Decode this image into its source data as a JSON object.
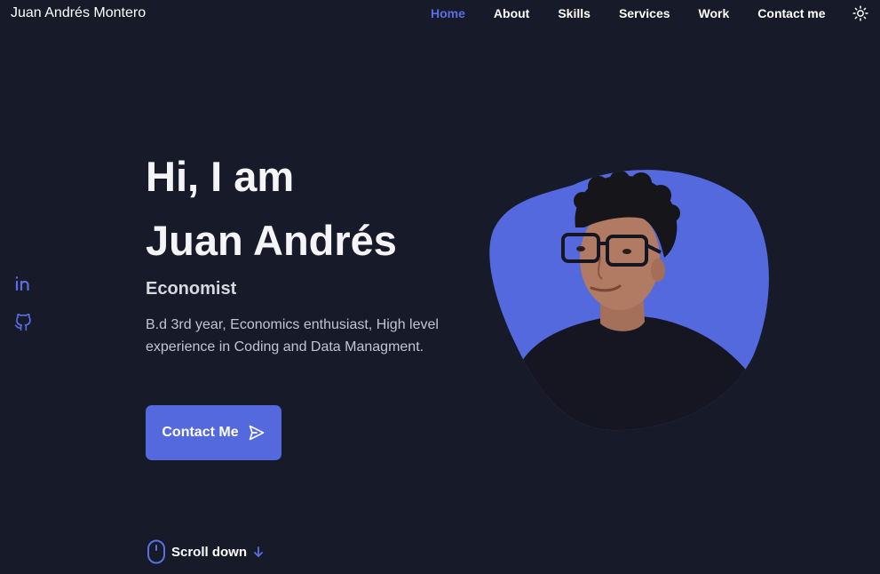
{
  "header": {
    "logo": "Juan Andrés Montero",
    "nav": [
      {
        "label": "Home",
        "active": true
      },
      {
        "label": "About"
      },
      {
        "label": "Skills"
      },
      {
        "label": "Services"
      },
      {
        "label": "Work"
      },
      {
        "label": "Contact me"
      }
    ],
    "theme_icon": "sun-icon"
  },
  "social": [
    {
      "icon": "linkedin-icon"
    },
    {
      "icon": "github-icon"
    }
  ],
  "hero": {
    "greeting": "Hi, I am",
    "name": "Juan Andrés",
    "role": "Economist",
    "description": "B.d 3rd year, Economics enthusiast, High level experience in Coding and Data Managment.",
    "button_label": "Contact Me",
    "button_icon": "send-icon"
  },
  "scroll": {
    "label": "Scroll down",
    "icon": "mouse-icon",
    "arrow_icon": "arrow-down-icon"
  },
  "colors": {
    "background": "#171a29",
    "accent": "#5469de",
    "text": "#ffffff"
  }
}
